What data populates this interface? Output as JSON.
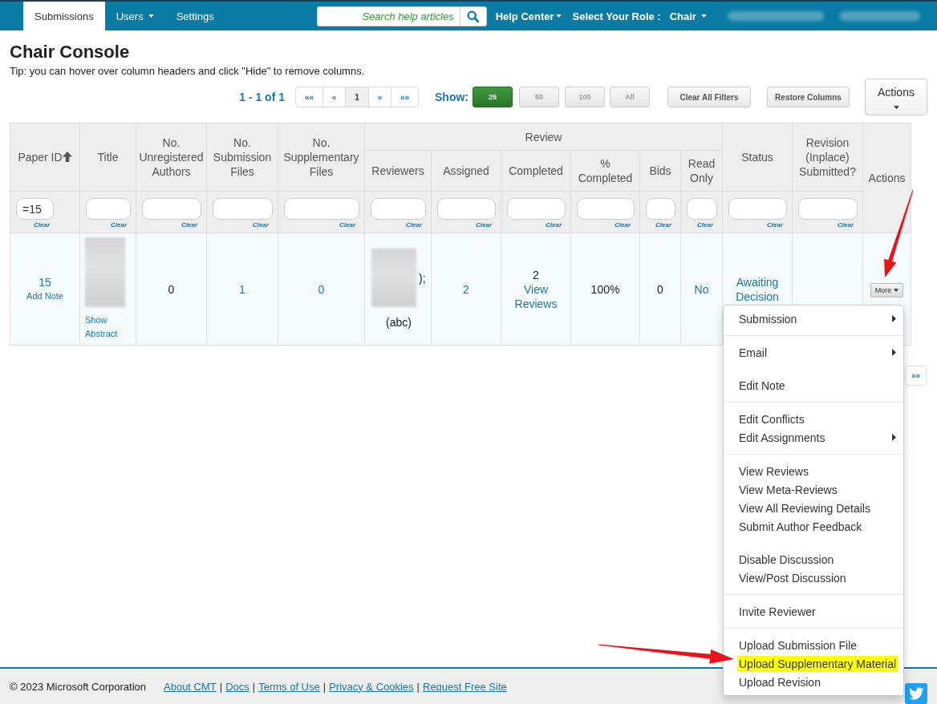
{
  "nav": {
    "tabs": [
      {
        "label": "Submissions",
        "selected": true,
        "dropdown": false
      },
      {
        "label": "Users",
        "selected": false,
        "dropdown": true
      },
      {
        "label": "Settings",
        "selected": false,
        "dropdown": false
      }
    ],
    "search": {
      "placeholder": "Search help articles"
    },
    "links": [
      {
        "label": "Help Center",
        "dropdown": true
      },
      {
        "label": "Select Your Role :",
        "dropdown": false
      },
      {
        "label": "Chair",
        "dropdown": true
      }
    ]
  },
  "page": {
    "title": "Chair Console",
    "tip": "Tip: you can hover over column headers and click \"Hide\" to remove columns."
  },
  "toolbar": {
    "summary": "1 - 1 of 1",
    "pager": [
      {
        "label": "««",
        "selected": false
      },
      {
        "label": "«",
        "selected": false
      },
      {
        "label": "1",
        "selected": true
      },
      {
        "label": "»",
        "selected": false
      },
      {
        "label": "»»",
        "selected": false
      }
    ],
    "show_label": "Show:",
    "page_sizes": [
      {
        "label": "25",
        "selected": true
      },
      {
        "label": "50",
        "selected": false
      },
      {
        "label": "100",
        "selected": false
      },
      {
        "label": "All",
        "selected": false
      }
    ],
    "buttons": [
      "Clear All Filters",
      "Restore Columns"
    ],
    "actions": "Actions"
  },
  "table": {
    "header": [
      {
        "kind": "column",
        "label": "Paper ID",
        "sorted": true,
        "filter": {
          "value": "=15",
          "clear": "Clear"
        }
      },
      {
        "kind": "column",
        "label": "Title",
        "sorted": false,
        "filter": {
          "clear": "Clear"
        }
      },
      {
        "kind": "column",
        "label": "No. Unregistered Authors",
        "sorted": false,
        "filter": {
          "clear": "Clear"
        }
      },
      {
        "kind": "column",
        "label": "No. Submission Files",
        "sorted": false,
        "filter": {
          "clear": "Clear"
        }
      },
      {
        "kind": "column",
        "label": "No. Supplementary Files",
        "sorted": false,
        "filter": {
          "clear": "Clear"
        }
      },
      {
        "kind": "group",
        "label": "Review",
        "columns": [
          {
            "kind": "column",
            "label": "Reviewers",
            "sorted": false,
            "filter": {
              "clear": "Clear"
            }
          },
          {
            "kind": "column",
            "label": "Assigned",
            "sorted": false,
            "filter": {
              "clear": "Clear"
            }
          },
          {
            "kind": "column",
            "label": "Completed",
            "sorted": false,
            "filter": {
              "clear": "Clear"
            }
          },
          {
            "kind": "column",
            "label": "% Completed",
            "sorted": false,
            "filter": {
              "clear": "Clear"
            }
          },
          {
            "kind": "column",
            "label": "Bids",
            "sorted": false,
            "filter": {
              "clear": "Clear"
            }
          },
          {
            "kind": "column",
            "label": "Read Only",
            "sorted": false,
            "filter": {
              "clear": "Clear"
            }
          }
        ]
      },
      {
        "kind": "column",
        "label": "Status",
        "sorted": false,
        "filter": {
          "clear": "Clear"
        }
      },
      {
        "kind": "column",
        "label": "Revision (Inplace) Submitted?",
        "sorted": false,
        "filter": {
          "clear": "Clear"
        }
      },
      {
        "kind": "column",
        "label": "Actions",
        "sorted": false
      }
    ],
    "rows": [
      {
        "cells": [
          {
            "parts": [
              {
                "kind": "link",
                "text": "15"
              },
              {
                "kind": "small_link",
                "text": "Add Note"
              }
            ]
          },
          {
            "parts": [
              {
                "kind": "redacted"
              },
              {
                "kind": "small_link",
                "text": "Show Abstract"
              }
            ]
          },
          {
            "parts": [
              {
                "kind": "text",
                "text": "0"
              }
            ]
          },
          {
            "parts": [
              {
                "kind": "link",
                "text": "1"
              }
            ]
          },
          {
            "parts": [
              {
                "kind": "link",
                "text": "0"
              }
            ]
          },
          {
            "parts": [
              {
                "kind": "redacted",
                "text": ");"
              },
              {
                "kind": "text",
                "text": "(abc)"
              }
            ]
          },
          {
            "parts": [
              {
                "kind": "link",
                "text": "2"
              }
            ]
          },
          {
            "parts": [
              {
                "kind": "text",
                "text": "2"
              },
              {
                "kind": "link",
                "text": "View Reviews"
              }
            ]
          },
          {
            "parts": [
              {
                "kind": "text",
                "text": "100%"
              }
            ]
          },
          {
            "parts": [
              {
                "kind": "text",
                "text": "0"
              }
            ]
          },
          {
            "parts": [
              {
                "kind": "link",
                "text": "No"
              }
            ]
          },
          {
            "parts": [
              {
                "kind": "link",
                "text": "Awaiting Decision"
              }
            ]
          },
          {},
          {
            "parts": [
              {
                "kind": "button",
                "text": "More"
              }
            ]
          }
        ]
      }
    ]
  },
  "bottom_pager": [
    {
      "label": "»»"
    }
  ],
  "menu": {
    "groups": [
      {
        "sections": [
          [
            {
              "label": "Submission",
              "submenu": true,
              "highlighted": false
            }
          ]
        ]
      },
      {
        "sections": [
          [
            {
              "label": "Email",
              "submenu": true,
              "highlighted": false
            }
          ],
          [
            {
              "label": "Edit Note",
              "submenu": false,
              "highlighted": false
            }
          ]
        ]
      },
      {
        "sections": [
          [
            {
              "label": "Edit Conflicts",
              "submenu": false,
              "highlighted": false
            },
            {
              "label": "Edit Assignments",
              "submenu": true,
              "highlighted": false
            }
          ]
        ]
      },
      {
        "sections": [
          [
            {
              "label": "View Reviews",
              "submenu": false,
              "highlighted": false
            },
            {
              "label": "View Meta-Reviews",
              "submenu": false,
              "highlighted": false
            },
            {
              "label": "View All Reviewing Details",
              "submenu": false,
              "highlighted": false
            },
            {
              "label": "Submit Author Feedback",
              "submenu": false,
              "highlighted": false
            }
          ],
          [
            {
              "label": "Disable Discussion",
              "submenu": false,
              "highlighted": false
            },
            {
              "label": "View/Post Discussion",
              "submenu": false,
              "highlighted": false
            }
          ]
        ]
      },
      {
        "sections": [
          [
            {
              "label": "Invite Reviewer",
              "submenu": false,
              "highlighted": false
            }
          ]
        ]
      },
      {
        "sections": [
          [
            {
              "label": "Upload Submission File",
              "submenu": false,
              "highlighted": false
            },
            {
              "label": "Upload Supplementary Material",
              "submenu": false,
              "highlighted": true
            },
            {
              "label": "Upload Revision",
              "submenu": false,
              "highlighted": false
            }
          ]
        ]
      }
    ]
  },
  "footer": {
    "copyright": "© 2023 Microsoft Corporation",
    "links": [
      {
        "label": "About CMT",
        "separator": "|"
      },
      {
        "label": "Docs",
        "separator": "|"
      },
      {
        "label": "Terms of Use",
        "separator": "|"
      },
      {
        "label": "Privacy & Cookies",
        "separator": "|"
      },
      {
        "label": "Request Free Site"
      }
    ]
  }
}
